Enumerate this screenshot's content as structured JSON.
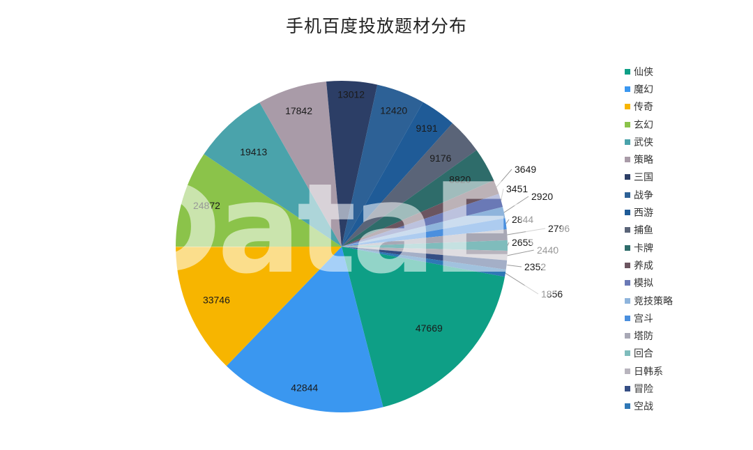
{
  "chart_data": {
    "type": "pie",
    "title": "手机百度投放题材分布",
    "categories": [
      "仙侠",
      "魔幻",
      "传奇",
      "玄幻",
      "武侠",
      "策略",
      "三国",
      "战争",
      "西游",
      "捕鱼",
      "卡牌",
      "养成",
      "模拟",
      "竞技策略",
      "宫斗",
      "塔防",
      "回合",
      "日韩系",
      "冒险",
      "空战"
    ],
    "values": [
      47669,
      42844,
      33746,
      24872,
      19413,
      17842,
      13012,
      12420,
      9191,
      9176,
      8820,
      3649,
      3451,
      2920,
      2844,
      2796,
      2655,
      2440,
      2352,
      1856
    ],
    "colors": [
      "#0e9f86",
      "#3a97f0",
      "#f7b500",
      "#8bc34a",
      "#4aa3ab",
      "#a99ba8",
      "#2c3e66",
      "#2d6196",
      "#1f5b97",
      "#5a6478",
      "#2e6c6a",
      "#6b5560",
      "#6a79b6",
      "#8eb4dc",
      "#4a8fde",
      "#a8a8b5",
      "#7fbcbc",
      "#b8b4bd",
      "#354e84",
      "#2f78b6"
    ],
    "legend": "right",
    "watermark": "DataEye"
  }
}
